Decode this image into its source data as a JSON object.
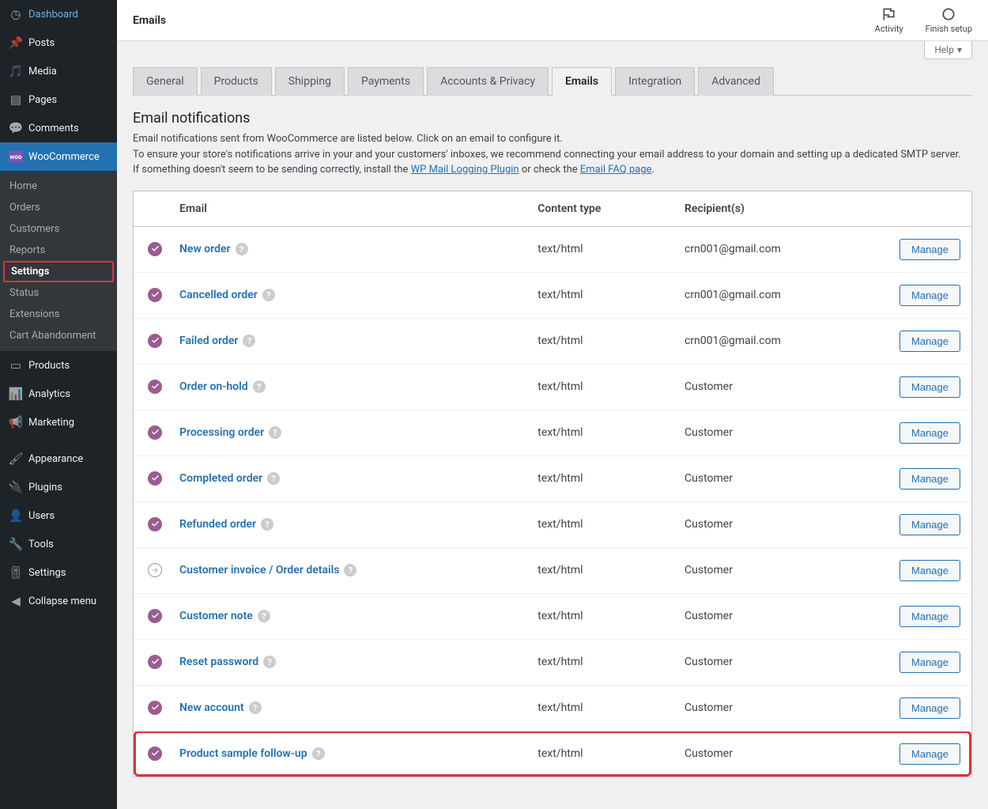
{
  "header": {
    "title": "Emails",
    "activity": "Activity",
    "finish": "Finish setup",
    "help": "Help"
  },
  "sidebar": {
    "items": [
      {
        "icon": "dashboard",
        "label": "Dashboard"
      },
      {
        "icon": "pin",
        "label": "Posts"
      },
      {
        "icon": "media",
        "label": "Media"
      },
      {
        "icon": "pages",
        "label": "Pages"
      },
      {
        "icon": "comments",
        "label": "Comments"
      },
      {
        "icon": "woo",
        "label": "WooCommerce"
      },
      {
        "icon": "products",
        "label": "Products"
      },
      {
        "icon": "analytics",
        "label": "Analytics"
      },
      {
        "icon": "marketing",
        "label": "Marketing"
      },
      {
        "icon": "appearance",
        "label": "Appearance"
      },
      {
        "icon": "plugins",
        "label": "Plugins"
      },
      {
        "icon": "users",
        "label": "Users"
      },
      {
        "icon": "tools",
        "label": "Tools"
      },
      {
        "icon": "settings",
        "label": "Settings"
      },
      {
        "icon": "collapse",
        "label": "Collapse menu"
      }
    ],
    "submenu": [
      "Home",
      "Orders",
      "Customers",
      "Reports",
      "Settings",
      "Status",
      "Extensions",
      "Cart Abandonment"
    ]
  },
  "tabs": [
    "General",
    "Products",
    "Shipping",
    "Payments",
    "Accounts & Privacy",
    "Emails",
    "Integration",
    "Advanced"
  ],
  "section": {
    "title": "Email notifications",
    "desc_line1": "Email notifications sent from WooCommerce are listed below. Click on an email to configure it.",
    "desc_line2a": "To ensure your store's notifications arrive in your and your customers' inboxes, we recommend connecting your email address to your domain and setting up a dedicated SMTP server. If something doesn't seem to be sending correctly, install the ",
    "link1": "WP Mail Logging Plugin",
    "desc_line2b": " or check the ",
    "link2": "Email FAQ page",
    "desc_line2c": "."
  },
  "table": {
    "headers": {
      "email": "Email",
      "content_type": "Content type",
      "recipients": "Recipient(s)"
    },
    "manage": "Manage",
    "rows": [
      {
        "status": "on",
        "name": "New order",
        "ct": "text/html",
        "rc": "crn001@gmail.com",
        "help": true
      },
      {
        "status": "on",
        "name": "Cancelled order",
        "ct": "text/html",
        "rc": "crn001@gmail.com",
        "help": true
      },
      {
        "status": "on",
        "name": "Failed order",
        "ct": "text/html",
        "rc": "crn001@gmail.com",
        "help": true
      },
      {
        "status": "on",
        "name": "Order on-hold",
        "ct": "text/html",
        "rc": "Customer",
        "help": true
      },
      {
        "status": "on",
        "name": "Processing order",
        "ct": "text/html",
        "rc": "Customer",
        "help": true
      },
      {
        "status": "on",
        "name": "Completed order",
        "ct": "text/html",
        "rc": "Customer",
        "help": true
      },
      {
        "status": "on",
        "name": "Refunded order",
        "ct": "text/html",
        "rc": "Customer",
        "help": true
      },
      {
        "status": "manual",
        "name": "Customer invoice / Order details",
        "ct": "text/html",
        "rc": "Customer",
        "help": true
      },
      {
        "status": "on",
        "name": "Customer note",
        "ct": "text/html",
        "rc": "Customer",
        "help": true
      },
      {
        "status": "on",
        "name": "Reset password",
        "ct": "text/html",
        "rc": "Customer",
        "help": true
      },
      {
        "status": "on",
        "name": "New account",
        "ct": "text/html",
        "rc": "Customer",
        "help": true
      },
      {
        "status": "on",
        "name": "Product sample follow-up",
        "ct": "text/html",
        "rc": "Customer",
        "help": true,
        "highlight": true
      }
    ]
  }
}
